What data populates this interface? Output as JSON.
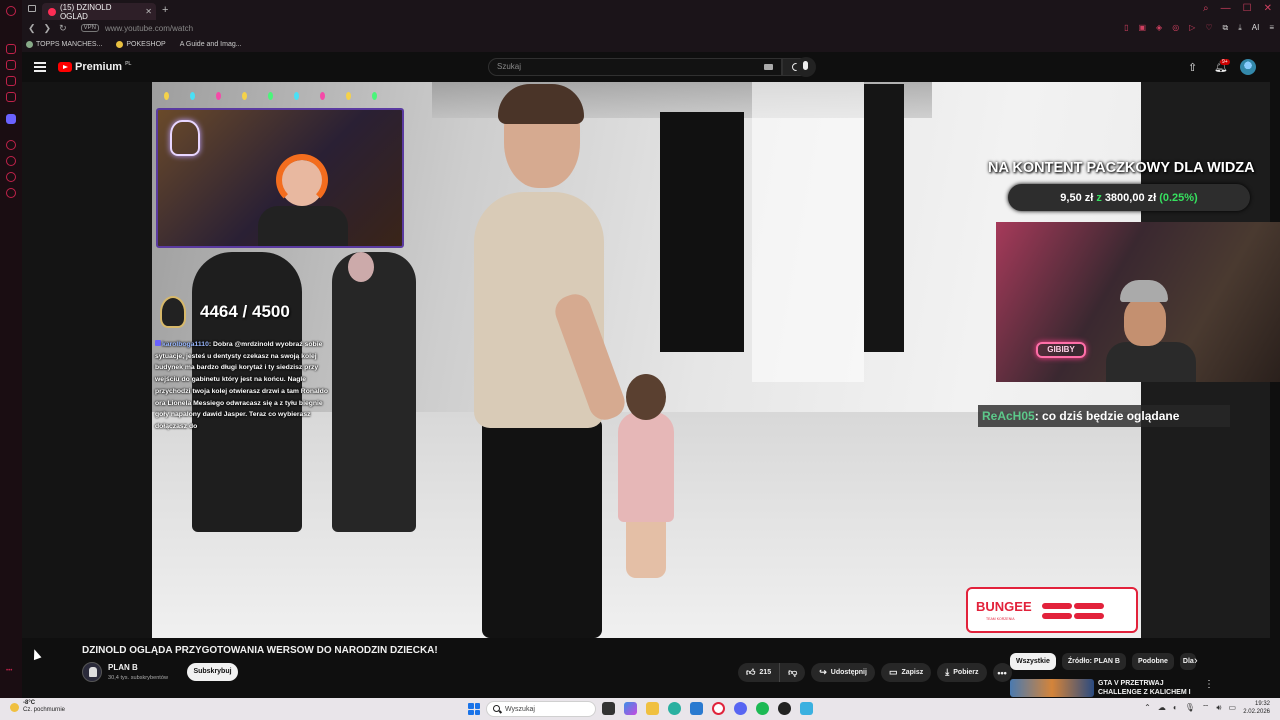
{
  "browser": {
    "tab_title": "(15) DZINOLD OGLĄD",
    "address": "www.youtube.com/watch",
    "vpn_label": "VPN",
    "ai_label": "AI",
    "bookmarks": [
      "TOPPS MANCHES...",
      "POKESHOP",
      "A Guide and Imag..."
    ]
  },
  "youtube": {
    "logo_text": "Premium",
    "logo_region": "PL",
    "search_placeholder": "Szukaj",
    "notification_count": "9+"
  },
  "overlay": {
    "goal_counter": "4464 / 4500",
    "chat_user": "karolboga1110",
    "chat_message": ": Dobra @mrdzinold wyobraź sobie sytuacje, jesteś u dentysty czekasz na swoją kolej budynek ma bardzo długi korytaż i ty siedzisz przy wejściu do gabinetu który jest na końcu. Nagle przychodzi twoja kolej otwierasz drzwi a tam Ronaldo ora Lionela Messiego odwracasz się a z tyłu biegnie goły napalony dawid Jasper. Teraz co wybierasz dołączasz do",
    "promo_title": "NA KONTENT PACZKOWY DLA WIDZA",
    "promo_current": "9,50 zł",
    "promo_z": "z",
    "promo_target": "3800,00 zł",
    "promo_percent": "(0.25%)",
    "webcam2_neon": "GIBIBY",
    "chat2_user": "ReAcH05",
    "chat2_message": ": co dziś będzie oglądane",
    "sponsor_name": "BUNGEE",
    "sponsor_sub": "TEAM KORZENIA"
  },
  "video": {
    "title": "DZINOLD OGLĄDA PRZYGOTOWANIA WERSOW DO NARODZIN DZIECKA!",
    "channel_name": "PLAN B",
    "subscribers": "30,4 tys. subskrybentów",
    "subscribe_label": "Subskrybuj",
    "likes": "215",
    "share_label": "Udostępnij",
    "save_label": "Zapisz",
    "download_label": "Pobierz"
  },
  "sidebar_chips": [
    "Wszystkie",
    "Źródło: PLAN B",
    "Podobne",
    "Dla"
  ],
  "recommendation": {
    "title": "GTA V PRZETRWAJ CHALLENGE Z KALICHEM I"
  },
  "taskbar": {
    "weather_temp": "-8°C",
    "weather_desc": "Cz. pochmurnie",
    "search_placeholder": "Wyszukaj",
    "time": "19:32",
    "date": "2.02.2026"
  }
}
